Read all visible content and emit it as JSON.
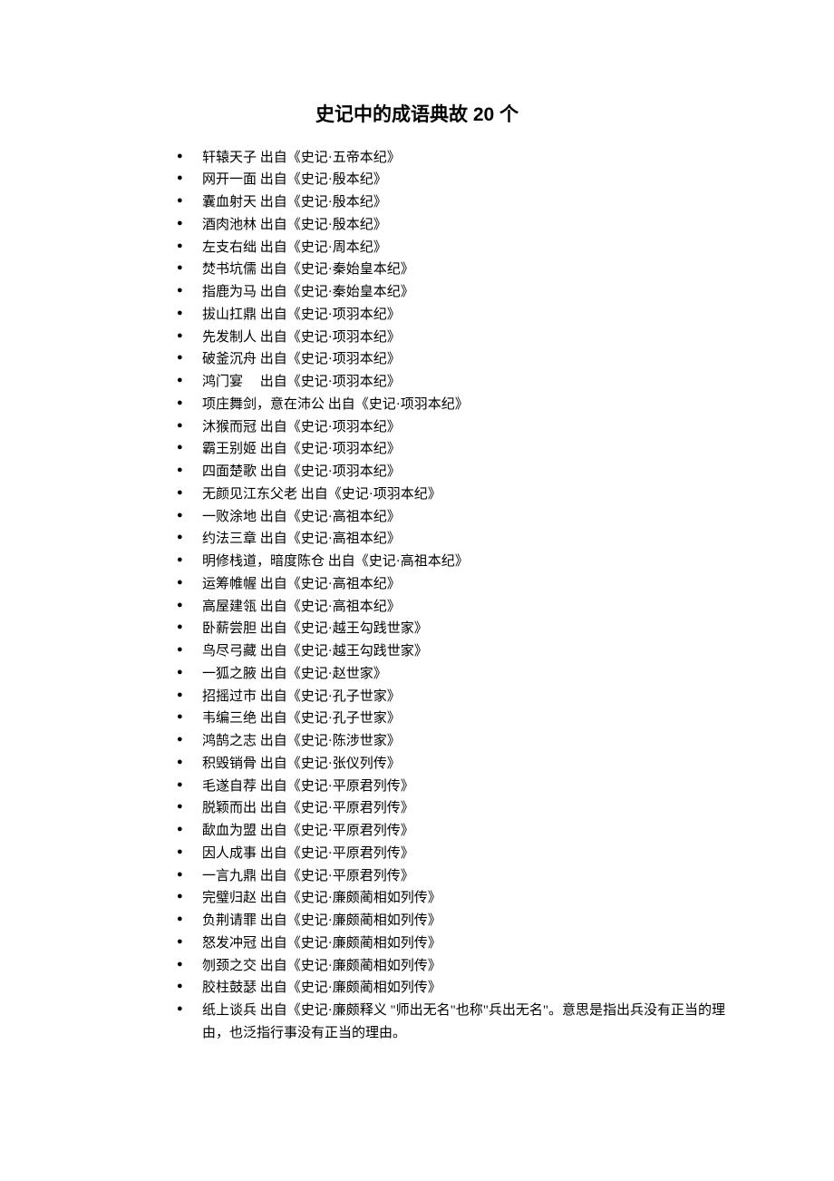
{
  "title": "史记中的成语典故 20 个",
  "items": [
    {
      "text": "轩辕天子 出自《史记·五帝本纪》"
    },
    {
      "text": "网开一面 出自《史记·殷本纪》"
    },
    {
      "text": "囊血射天 出自《史记·殷本纪》"
    },
    {
      "text": "酒肉池林 出自《史记·殷本纪》"
    },
    {
      "text": "左支右绌 出自《史记·周本纪》"
    },
    {
      "text": "焚书坑儒 出自《史记·秦始皇本纪》"
    },
    {
      "text": "指鹿为马 出自《史记·秦始皇本纪》"
    },
    {
      "text": "拔山扛鼎 出自《史记·项羽本纪》"
    },
    {
      "text": "先发制人 出自《史记·项羽本纪》"
    },
    {
      "text": "破釜沉舟 出自《史记·项羽本纪》"
    },
    {
      "text": "鸿门宴 　出自《史记·项羽本纪》"
    },
    {
      "text": "项庄舞剑，意在沛公 出自《史记·项羽本纪》"
    },
    {
      "text": "沐猴而冠 出自《史记·项羽本纪》"
    },
    {
      "text": "霸王别姬 出自《史记·项羽本纪》"
    },
    {
      "text": "四面楚歌 出自《史记·项羽本纪》"
    },
    {
      "text": "无颜见江东父老 出自《史记·项羽本纪》"
    },
    {
      "text": "一败涂地 出自《史记·高祖本纪》"
    },
    {
      "text": "约法三章 出自《史记·高祖本纪》"
    },
    {
      "text": "明修栈道，暗度陈仓 出自《史记·高祖本纪》"
    },
    {
      "text": "运筹帷幄 出自《史记·高祖本纪》"
    },
    {
      "text": "高屋建瓴 出自《史记·高祖本纪》"
    },
    {
      "text": "卧薪尝胆 出自《史记·越王勾践世家》"
    },
    {
      "text": "鸟尽弓藏 出自《史记·越王勾践世家》"
    },
    {
      "text": "一狐之腋 出自《史记·赵世家》"
    },
    {
      "text": "招摇过市 出自《史记·孔子世家》"
    },
    {
      "text": "韦编三绝 出自《史记·孔子世家》"
    },
    {
      "text": "鸿鹄之志 出自《史记·陈涉世家》"
    },
    {
      "text": "积毁销骨 出自《史记·张仪列传》"
    },
    {
      "text": "毛遂自荐 出自《史记·平原君列传》"
    },
    {
      "text": "脱颖而出 出自《史记·平原君列传》"
    },
    {
      "text": "歃血为盟 出自《史记·平原君列传》"
    },
    {
      "text": "因人成事 出自《史记·平原君列传》"
    },
    {
      "text": "一言九鼎 出自《史记·平原君列传》"
    },
    {
      "text": "完璧归赵 出自《史记·廉颇蔺相如列传》"
    },
    {
      "text": "负荆请罪 出自《史记·廉颇蔺相如列传》"
    },
    {
      "text": "怒发冲冠 出自《史记·廉颇蔺相如列传》"
    },
    {
      "text": "刎颈之交 出自《史记·廉颇蔺相如列传》"
    },
    {
      "text": "胶柱鼓瑟 出自《史记·廉颇蔺相如列传》"
    },
    {
      "text": "纸上谈兵 出自《史记·廉颇释义 \"师出无名\"也称\"兵出无名\"。意思是指出兵没有正当的理由，也泛指行事没有正当的理由。"
    }
  ]
}
